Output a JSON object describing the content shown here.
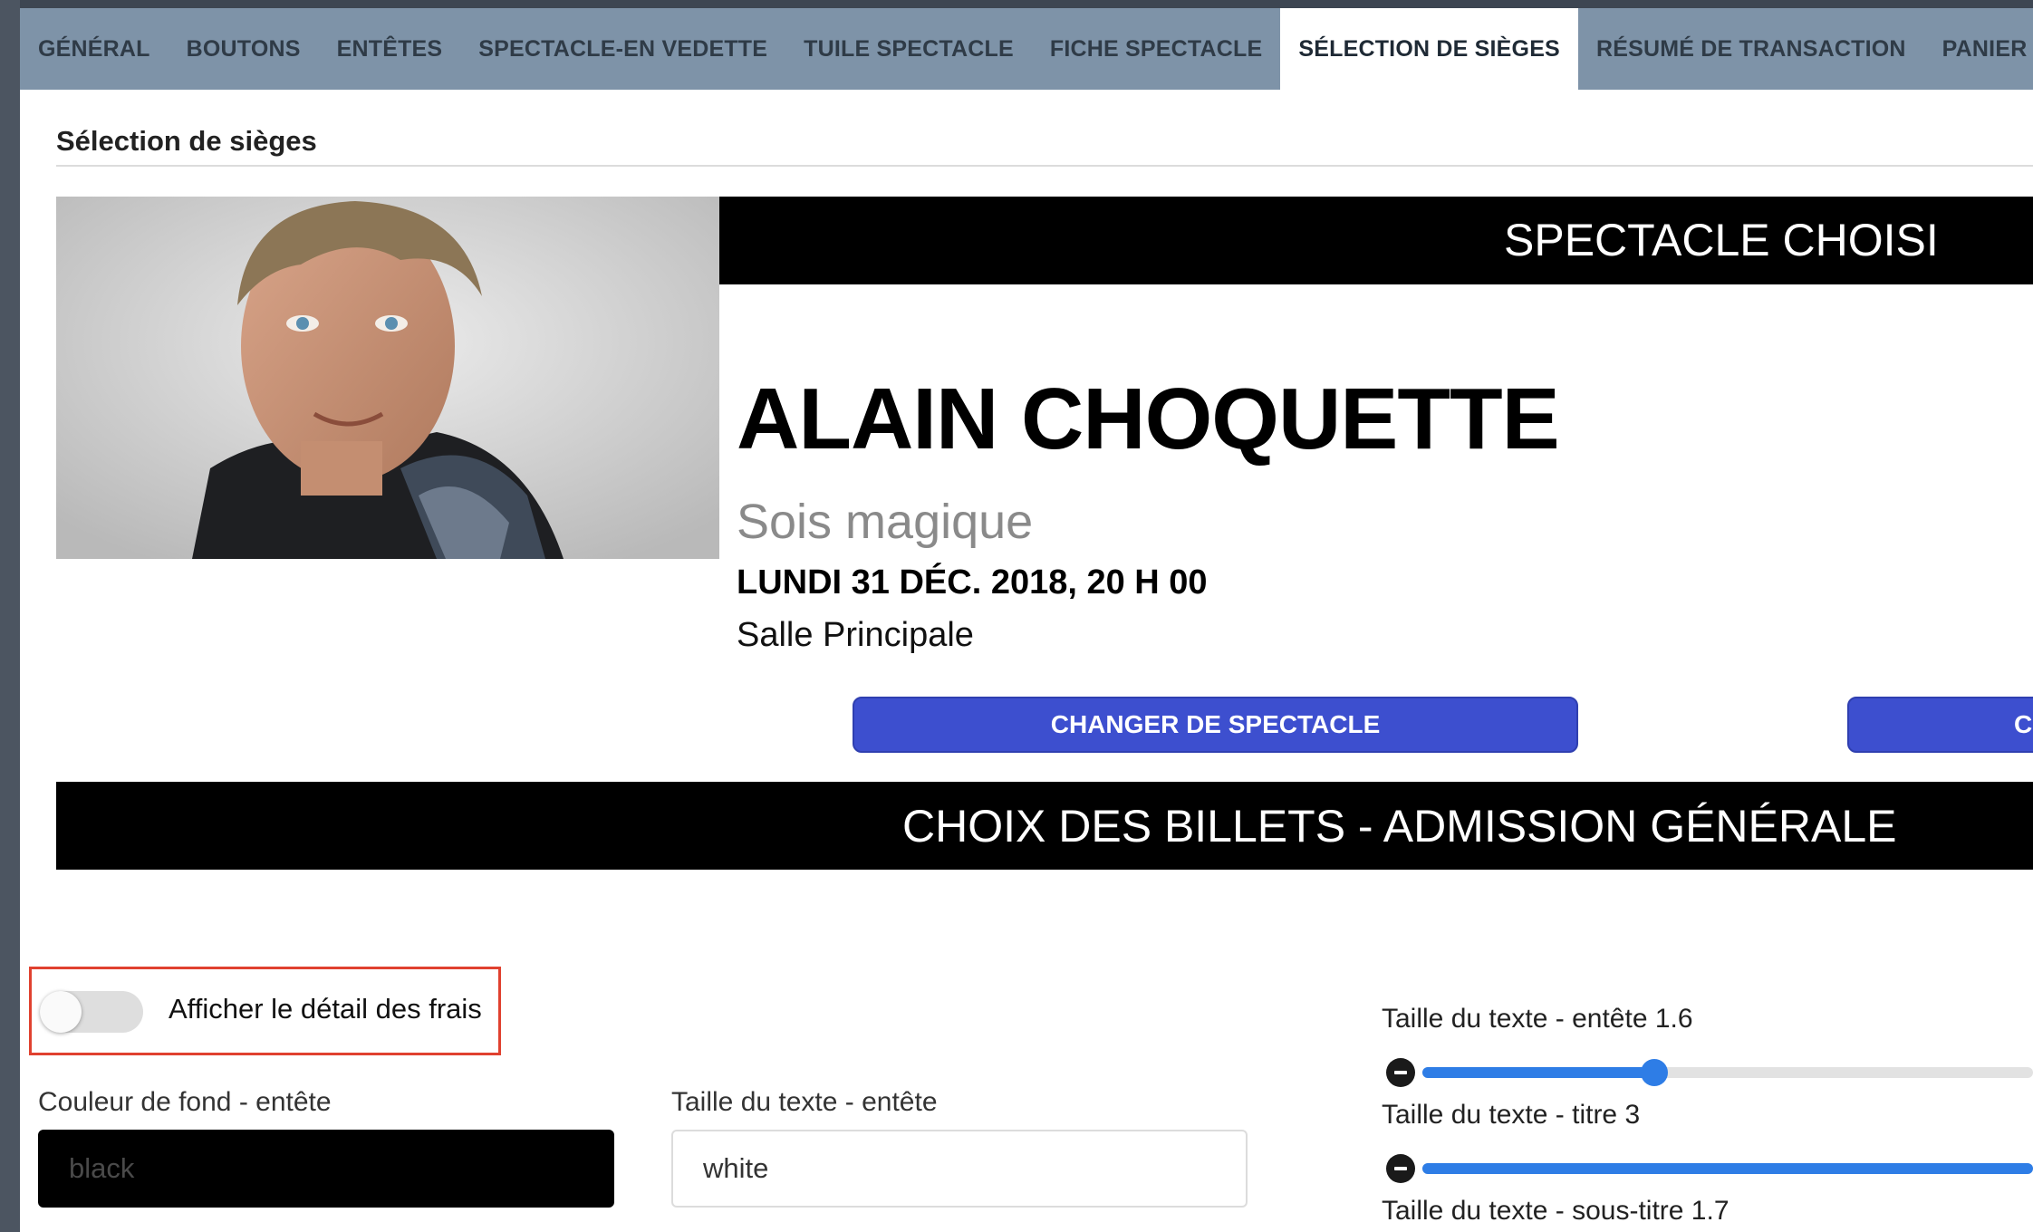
{
  "tabs": [
    {
      "label": "GÉNÉRAL",
      "active": false
    },
    {
      "label": "BOUTONS",
      "active": false
    },
    {
      "label": "ENTÊTES",
      "active": false
    },
    {
      "label": "SPECTACLE-EN VEDETTE",
      "active": false
    },
    {
      "label": "TUILE SPECTACLE",
      "active": false
    },
    {
      "label": "FICHE SPECTACLE",
      "active": false
    },
    {
      "label": "SÉLECTION DE SIÈGES",
      "active": true
    },
    {
      "label": "RÉSUMÉ DE TRANSACTION",
      "active": false
    },
    {
      "label": "PANIER D'ACHAT",
      "active": false
    }
  ],
  "section_title": "Sélection de sièges",
  "preview": {
    "header_bar": "SPECTACLE CHOISI",
    "title": "ALAIN CHOQUETTE",
    "subtitle": "Sois magique",
    "date": "LUNDI 31 DÉC. 2018, 20 H 00",
    "venue": "Salle Principale",
    "change_button": "CHANGER DE SPECTACLE",
    "second_button": "C",
    "choice_bar": "CHOIX DES BILLETS - ADMISSION GÉNÉRALE"
  },
  "settings": {
    "fees_toggle": {
      "label": "Afficher le détail des frais",
      "on": false
    },
    "bg_color": {
      "label": "Couleur de fond - entête",
      "value": "black"
    },
    "text_color": {
      "label": "Taille du texte - entête",
      "value": "white"
    },
    "sliders": [
      {
        "label": "Taille du texte - entête 1.6",
        "fill": 0.38
      },
      {
        "label": "Taille du texte - titre 3",
        "fill": 1.0
      },
      {
        "label": "Taille du texte - sous-titre 1.7",
        "fill": null
      }
    ]
  },
  "colors": {
    "accent_button": "#3d4fcf",
    "slider": "#2e7de6",
    "highlight": "#e0412f",
    "tab_bar": "#7e93a8"
  }
}
